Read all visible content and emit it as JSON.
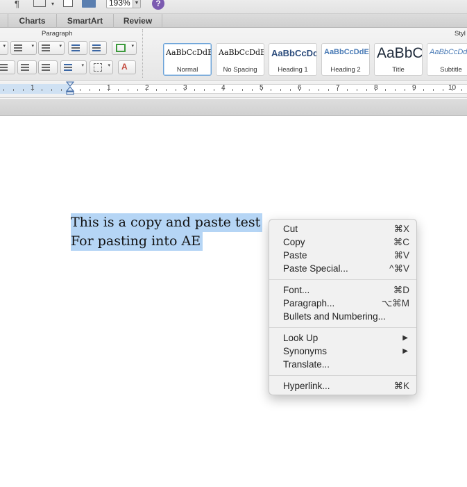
{
  "toolbar": {
    "zoom_value": "193%"
  },
  "ribbon_tabs": [
    "Charts",
    "SmartArt",
    "Review"
  ],
  "ribbon": {
    "paragraph_group_label": "Paragraph",
    "styles_group_label": "Styl",
    "styles": [
      {
        "sample": "AaBbCcDdEe",
        "name": "Normal",
        "selected": true
      },
      {
        "sample": "AaBbCcDdEe",
        "name": "No Spacing",
        "selected": false
      },
      {
        "sample": "AaBbCcDc",
        "name": "Heading 1",
        "selected": false
      },
      {
        "sample": "AaBbCcDdEe",
        "name": "Heading 2",
        "selected": false
      },
      {
        "sample": "AaBbC(",
        "name": "Title",
        "selected": false
      },
      {
        "sample": "AaBbCcDd",
        "name": "Subtitle",
        "selected": false
      }
    ]
  },
  "ruler": {
    "numbers": [
      "1",
      "1",
      "2",
      "3",
      "4",
      "5",
      "6",
      "7",
      "8",
      "9",
      "10"
    ]
  },
  "document": {
    "lines": [
      "This is a copy and paste test",
      "For pasting into AE"
    ]
  },
  "context_menu": {
    "groups": [
      [
        {
          "label": "Cut",
          "shortcut": "⌘X"
        },
        {
          "label": "Copy",
          "shortcut": "⌘C"
        },
        {
          "label": "Paste",
          "shortcut": "⌘V"
        },
        {
          "label": "Paste Special...",
          "shortcut": "^⌘V"
        }
      ],
      [
        {
          "label": "Font...",
          "shortcut": "⌘D"
        },
        {
          "label": "Paragraph...",
          "shortcut": "⌥⌘M"
        },
        {
          "label": "Bullets and Numbering...",
          "shortcut": ""
        }
      ],
      [
        {
          "label": "Look Up",
          "shortcut": "",
          "submenu": true
        },
        {
          "label": "Synonyms",
          "shortcut": "",
          "submenu": true
        },
        {
          "label": "Translate...",
          "shortcut": ""
        }
      ],
      [
        {
          "label": "Hyperlink...",
          "shortcut": "⌘K"
        }
      ]
    ]
  }
}
